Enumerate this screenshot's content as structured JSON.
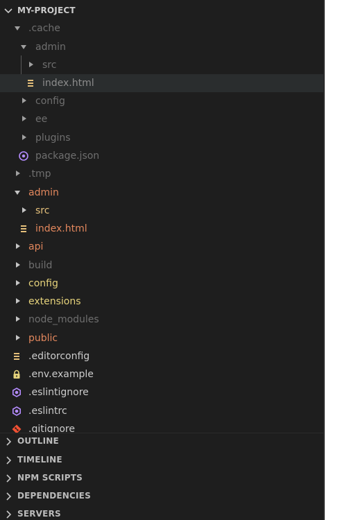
{
  "explorer": {
    "project_title": "MY-PROJECT",
    "items": [
      {
        "label": ".cache",
        "color": "#6f6f6f"
      },
      {
        "label": "admin",
        "color": "#6f6f6f"
      },
      {
        "label": "src",
        "color": "#6f6f6f"
      },
      {
        "label": "index.html",
        "color": "#8c8c8c"
      },
      {
        "label": "config",
        "color": "#6f6f6f"
      },
      {
        "label": "ee",
        "color": "#6f6f6f"
      },
      {
        "label": "plugins",
        "color": "#6f6f6f"
      },
      {
        "label": "package.json",
        "color": "#6f6f6f"
      },
      {
        "label": ".tmp",
        "color": "#6f6f6f"
      },
      {
        "label": "admin",
        "color": "#e2875d"
      },
      {
        "label": "src",
        "color": "#e5c07b"
      },
      {
        "label": "index.html",
        "color": "#e2875d"
      },
      {
        "label": "api",
        "color": "#e2875d"
      },
      {
        "label": "build",
        "color": "#6f6f6f"
      },
      {
        "label": "config",
        "color": "#e5d27b"
      },
      {
        "label": "extensions",
        "color": "#e5d27b"
      },
      {
        "label": "node_modules",
        "color": "#6f6f6f"
      },
      {
        "label": "public",
        "color": "#e2875d"
      },
      {
        "label": ".editorconfig",
        "color": "#cccccc"
      },
      {
        "label": ".env.example",
        "color": "#cccccc"
      },
      {
        "label": ".eslintignore",
        "color": "#cccccc"
      },
      {
        "label": ".eslintrc",
        "color": "#cccccc"
      },
      {
        "label": ".gitignore",
        "color": "#cccccc"
      }
    ]
  },
  "sections": {
    "outline": "OUTLINE",
    "timeline": "TIMELINE",
    "npm_scripts": "NPM SCRIPTS",
    "dependencies": "DEPENDENCIES",
    "servers": "SERVERS"
  },
  "icons": {
    "file_lines": "file-lines-icon",
    "package_json": "nodejs-icon",
    "lock": "lock-icon",
    "eslint": "eslint-icon",
    "git": "git-icon"
  },
  "colors": {
    "background": "#1e1e1e",
    "selection": "#2a2d2e",
    "ignored_text": "#6f6f6f",
    "modified_text": "#e2875d",
    "untracked_text": "#e5d27b",
    "file_icon": "#e5c07b",
    "eslint_icon": "#b58cff"
  }
}
